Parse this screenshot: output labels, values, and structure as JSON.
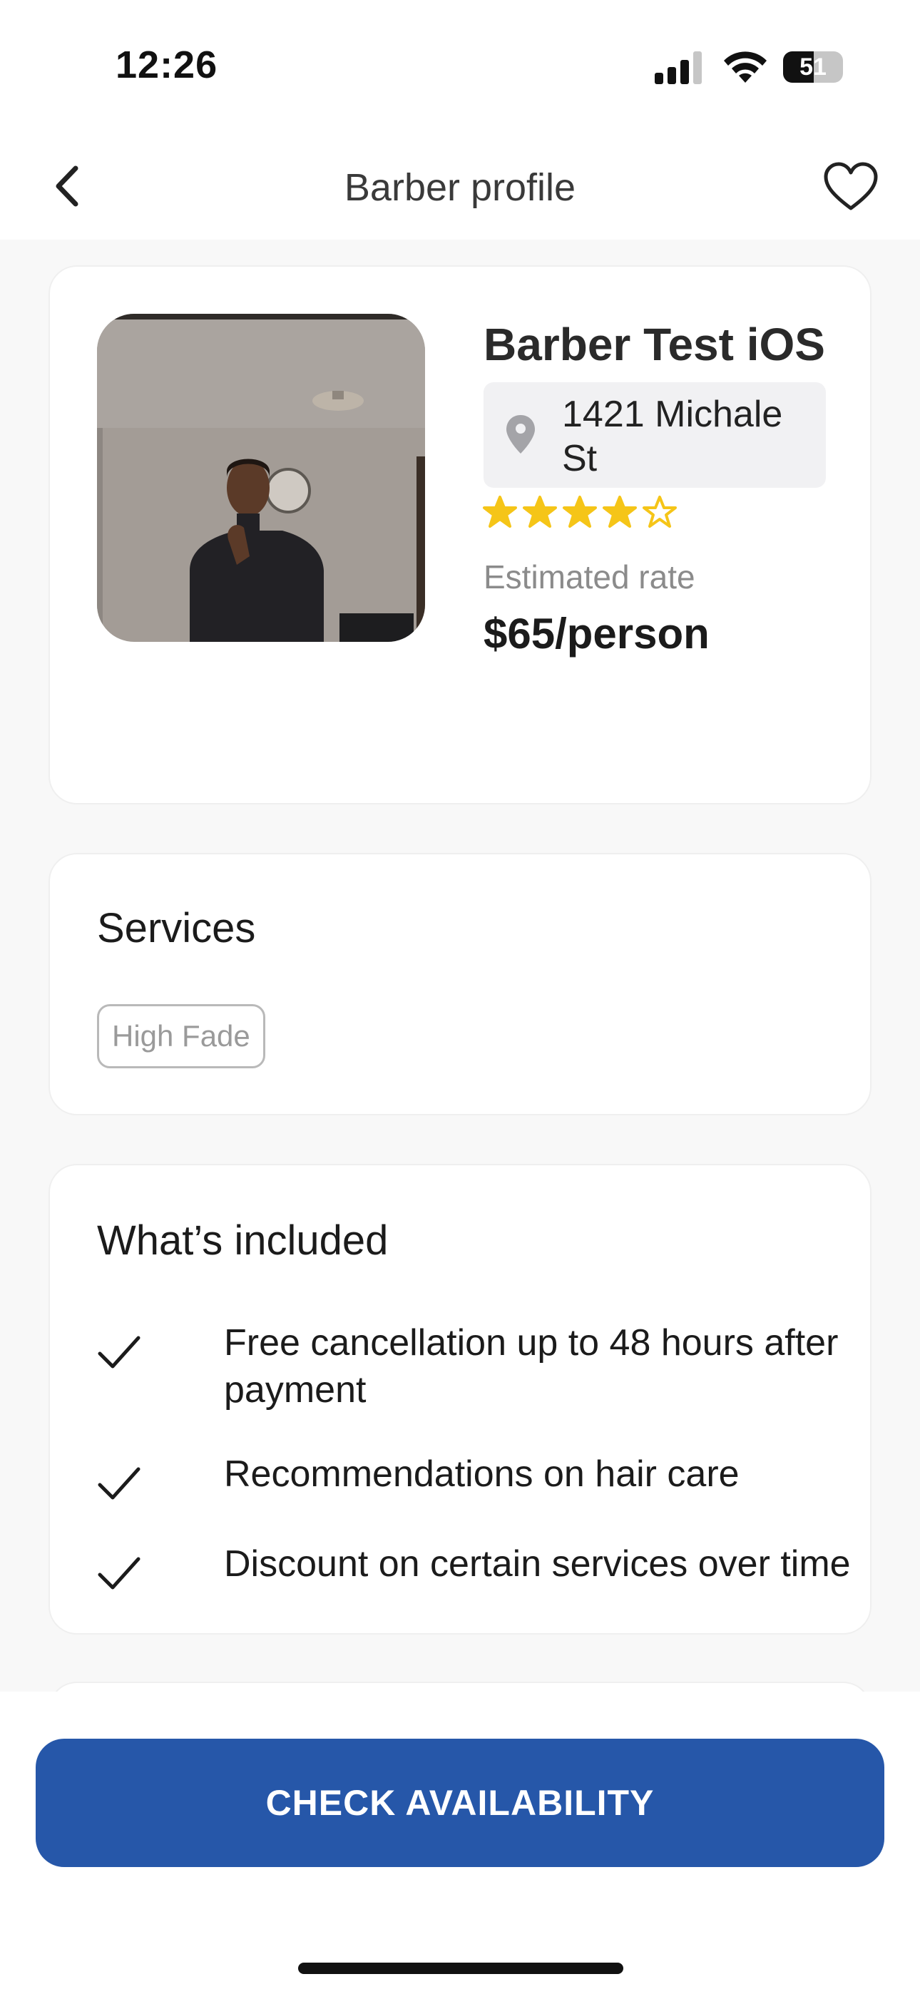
{
  "status_bar": {
    "time": "12:26",
    "battery_percent": "51",
    "battery_level": 0.51
  },
  "nav": {
    "title": "Barber profile",
    "back_icon": "chevron-left-icon",
    "favorite_icon": "heart-outline-icon"
  },
  "profile": {
    "name": "Barber Test iOS",
    "address": "1421 Michale St",
    "address_icon": "location-pin-icon",
    "rating": 4,
    "rating_max": 5,
    "rate_label": "Estimated rate",
    "rate_value": "$65/person"
  },
  "services": {
    "title": "Services",
    "tags": [
      "High Fade"
    ]
  },
  "included": {
    "title": "What’s included",
    "items": [
      "Free cancellation up to 48 hours after payment",
      "Recommendations on hair care",
      "Discount on certain services over time"
    ]
  },
  "cta": {
    "label": "CHECK AVAILABILITY"
  },
  "colors": {
    "primary": "#2657a9",
    "star": "#f5c518",
    "background": "#f8f8f8"
  }
}
